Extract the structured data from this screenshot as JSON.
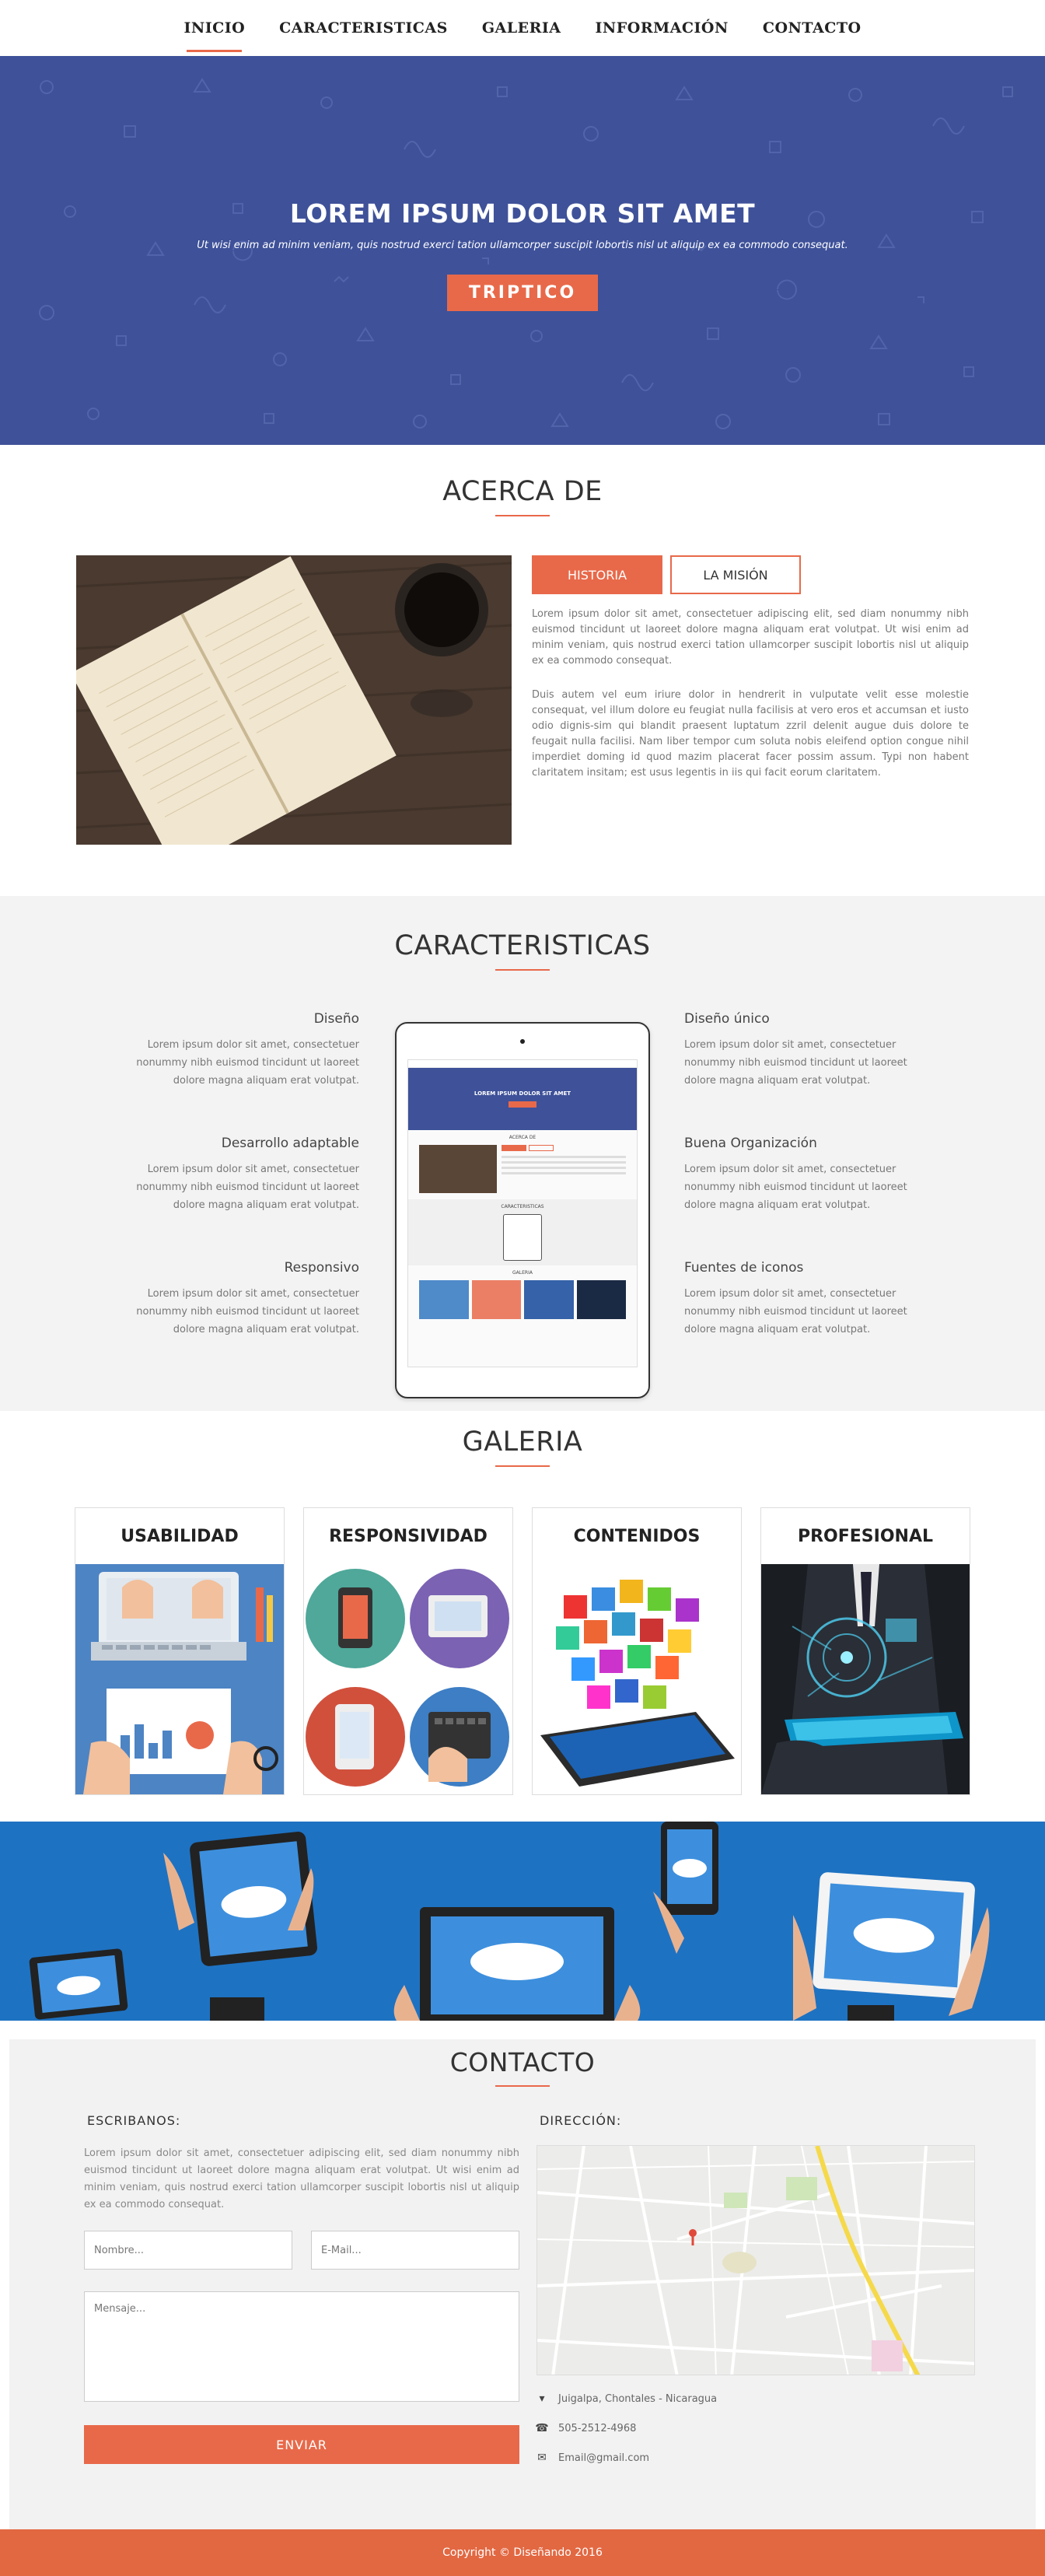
{
  "nav": {
    "items": [
      "INICIO",
      "CARACTERISTICAS",
      "GALERIA",
      "INFORMACIÓN",
      "CONTACTO"
    ],
    "active_index": 0
  },
  "hero": {
    "title": "LOREM IPSUM DOLOR SIT AMET",
    "subtitle": "Ut wisi enim ad minim veniam, quis nostrud exerci tation ullamcorper suscipit lobortis nisl ut aliquip ex ea commodo consequat.",
    "button": "TRIPTICO",
    "bg_color": "#3e5199"
  },
  "acerca": {
    "title": "ACERCA DE",
    "tabs": [
      "HISTORIA",
      "LA MISIÓN"
    ],
    "active_tab": 0,
    "paragraph1": "Lorem ipsum dolor sit amet, consectetuer adipiscing elit, sed diam nonummy nibh euismod tincidunt ut laoreet dolore magna aliquam erat volutpat. Ut wisi enim ad minim veniam, quis nostrud exerci tation ullamcorper suscipit lobortis nisl ut aliquip ex ea commodo consequat.",
    "paragraph2": "Duis autem vel eum iriure dolor in hendrerit in vulputate velit esse molestie consequat, vel illum dolore eu feugiat nulla facilisis at vero eros et accumsan et iusto odio dignis-sim qui blandit praesent luptatum zzril delenit augue duis dolore te feugait nulla facilisi. Nam liber tempor cum soluta nobis eleifend option congue nihil imperdiet doming id quod mazim placerat facer possim assum. Typi non habent claritatem insitam; est usus legentis in iis qui facit eorum claritatem."
  },
  "caracteristicas": {
    "title": "CARACTERISTICAS",
    "features_left": [
      {
        "title": "Diseño",
        "text": "Lorem ipsum dolor sit amet, consectetuer nonummy nibh euismod tincidunt ut laoreet dolore magna aliquam erat volutpat."
      },
      {
        "title": "Desarrollo adaptable",
        "text": "Lorem ipsum dolor sit amet, consectetuer nonummy nibh euismod tincidunt ut laoreet dolore magna aliquam erat volutpat."
      },
      {
        "title": "Responsivo",
        "text": "Lorem ipsum dolor sit amet, consectetuer nonummy nibh euismod tincidunt ut laoreet dolore magna aliquam erat volutpat."
      }
    ],
    "features_right": [
      {
        "title": "Diseño único",
        "text": "Lorem ipsum dolor sit amet, consectetuer nonummy nibh euismod tincidunt ut laoreet dolore magna aliquam erat volutpat."
      },
      {
        "title": "Buena Organización",
        "text": "Lorem ipsum dolor sit amet, consectetuer nonummy nibh euismod tincidunt ut laoreet dolore magna aliquam erat volutpat."
      },
      {
        "title": "Fuentes de iconos",
        "text": "Lorem ipsum dolor sit amet, consectetuer nonummy nibh euismod tincidunt ut laoreet dolore magna aliquam erat volutpat."
      }
    ],
    "tablet_screen": {
      "hero_title": "LOREM IPSUM DOLOR SIT AMET",
      "s1": "ACERCA DE",
      "s2": "CARACTERISTICAS",
      "s3": "GALERIA"
    }
  },
  "galeria": {
    "title": "GALERIA",
    "cards": [
      "USABILIDAD",
      "RESPONSIVIDAD",
      "CONTENIDOS",
      "PROFESIONAL"
    ]
  },
  "contacto": {
    "title": "CONTACTO",
    "left_heading": "ESCRIBANOS:",
    "right_heading": "DIRECCIÓN:",
    "text": "Lorem ipsum dolor sit amet, consectetuer adipiscing elit, sed diam nonummy nibh euismod tincidunt ut laoreet dolore magna aliquam erat volutpat. Ut wisi enim ad minim veniam, quis nostrud exerci tation ullamcorper suscipit lobortis nisl ut aliquip ex ea commodo consequat.",
    "name_placeholder": "Nombre...",
    "email_placeholder": "E-Mail...",
    "message_placeholder": "Mensaje...",
    "submit": "ENVIAR",
    "address": "Juigalpa, Chontales  -  Nicaragua",
    "phone": "505-2512-4968",
    "email": "Email@gmail.com"
  },
  "footer": {
    "text": "Copyright © Diseñando 2016"
  },
  "colors": {
    "accent": "#e8694a",
    "hero": "#3e5199",
    "banner": "#1e72c2"
  }
}
